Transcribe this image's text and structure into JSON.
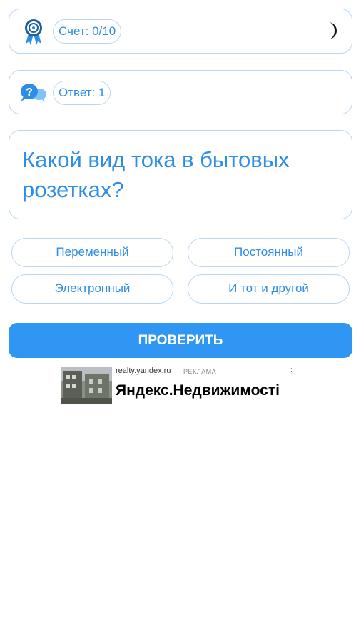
{
  "score": {
    "label": "Счет: 0/10"
  },
  "answer": {
    "label": "Ответ: 1"
  },
  "question": {
    "text": "Какой вид тока в бытовых розетках?"
  },
  "options": [
    {
      "label": "Переменный"
    },
    {
      "label": "Постоянный"
    },
    {
      "label": "Электронный"
    },
    {
      "label": "И тот и другой"
    }
  ],
  "check_button": {
    "label": "ПРОВЕРИТЬ"
  },
  "ad": {
    "domain": "realty.yandex.ru",
    "tag": "РЕКЛАМА",
    "menu": "⋮",
    "title": "Яндекс.Недвижимості"
  },
  "icons": {
    "medal": "medal-icon",
    "help": "help-chat-icon",
    "theme": "moon-icon"
  },
  "colors": {
    "accent": "#2e8de6",
    "button": "#2f96f3",
    "border": "#b9d6f5"
  }
}
